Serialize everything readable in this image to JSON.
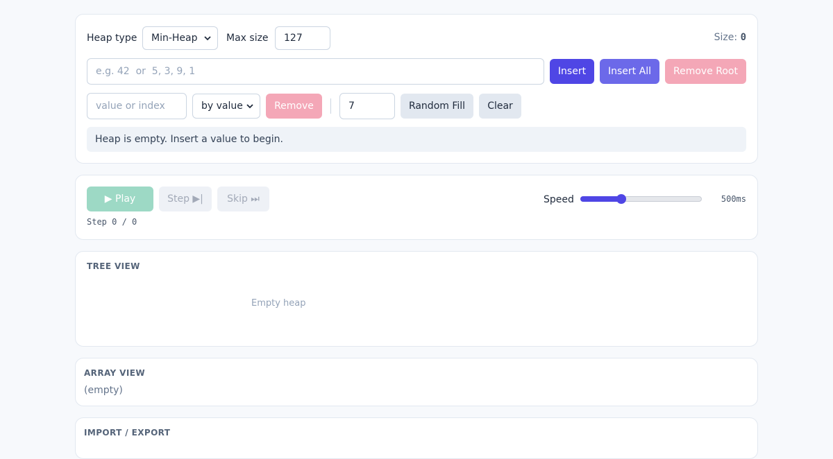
{
  "controls": {
    "heap_type_label": "Heap type",
    "heap_type_value": "Min-Heap",
    "max_size_label": "Max size",
    "max_size_value": "127",
    "size_label": "Size:",
    "size_value": "0",
    "insert_placeholder": "e.g. 42  or  5, 3, 9, 1",
    "insert_label": "Insert",
    "insert_all_label": "Insert All",
    "remove_root_label": "Remove Root",
    "remove_placeholder": "value or index",
    "remove_mode_value": "by value",
    "remove_label": "Remove",
    "random_count_value": "7",
    "random_fill_label": "Random Fill",
    "clear_label": "Clear",
    "status_message": "Heap is empty. Insert a value to begin."
  },
  "playback": {
    "play_label": "▶ Play",
    "step_label": "Step ▶|",
    "skip_label": "Skip ⏭",
    "step_counter": "Step 0 / 0",
    "speed_label": "Speed",
    "speed_value": "500ms",
    "speed_fraction": 0.32
  },
  "tree_view": {
    "title": "TREE VIEW",
    "empty_text": "Empty heap"
  },
  "array_view": {
    "title": "ARRAY VIEW",
    "empty_text": "(empty)"
  },
  "import_export": {
    "title": "IMPORT / EXPORT"
  },
  "colors": {
    "accent": "#4f46e5",
    "danger": "#f4a7b7",
    "success": "#9dd9c5"
  }
}
